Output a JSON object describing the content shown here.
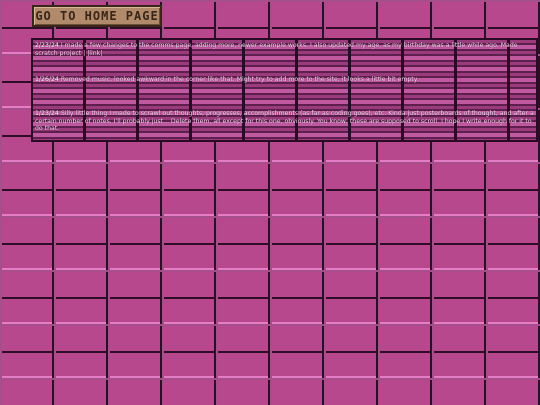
{
  "nav": {
    "home_label": "GO TO HOME PAGE"
  },
  "notes": [
    {
      "date": "2/23/24",
      "text": "I made a few changes to the comms page, adding more, newer example works. I also updated my age, as my birthday was a little while ago. Made scratch project |",
      "extra": "|link|"
    },
    {
      "date": "1/26/24",
      "text": "Removed music, looked awkward in the corner like that. Might try to add more to the site, it looks a little bit empty."
    },
    {
      "date": "1/23/24",
      "text": "Silly little thing I made to scrawl out thoughts, progresses, accomplishments (as far as coding goes), etc. Kinda just posterboards of thought, and after a certain number of notes, I'll probably just... Delete them, all except for this one, obviously. You know, these are supposed to scroll. I hope I write enough for it to do that."
    }
  ],
  "colors": {
    "page_bg": "#b8488e",
    "button_bg": "#b08a6a",
    "button_text": "#3a2618"
  }
}
